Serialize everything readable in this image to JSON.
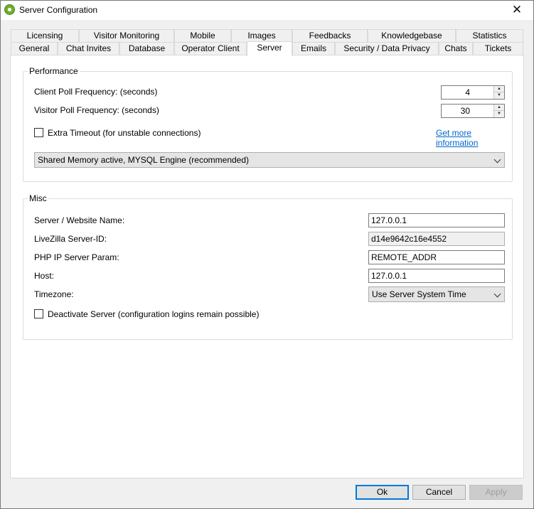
{
  "window": {
    "title": "Server Configuration",
    "close_glyph": "✕"
  },
  "tabs": {
    "row_back": [
      "Licensing",
      "Visitor Monitoring",
      "Mobile",
      "Images",
      "Feedbacks",
      "Knowledgebase",
      "Statistics"
    ],
    "row_front": [
      "General",
      "Chat Invites",
      "Database",
      "Operator Client",
      "Server",
      "Emails",
      "Security / Data Privacy",
      "Chats",
      "Tickets"
    ],
    "active": "Server"
  },
  "performance": {
    "legend": "Performance",
    "client_poll_label": "Client Poll Frequency: (seconds)",
    "client_poll_value": "4",
    "visitor_poll_label": "Visitor Poll Frequency: (seconds)",
    "visitor_poll_value": "30",
    "extra_timeout_label": "Extra Timeout (for unstable connections)",
    "extra_timeout_checked": false,
    "more_info_link": "Get more information",
    "engine_selected": "Shared Memory active, MYSQL Engine (recommended)"
  },
  "misc": {
    "legend": "Misc",
    "server_name_label": "Server / Website Name:",
    "server_name_value": "127.0.0.1",
    "server_id_label": "LiveZilla Server-ID:",
    "server_id_value": "d14e9642c16e4552",
    "php_ip_label": "PHP IP Server Param:",
    "php_ip_value": "REMOTE_ADDR",
    "host_label": "Host:",
    "host_value": "127.0.0.1",
    "timezone_label": "Timezone:",
    "timezone_selected": "Use Server System Time",
    "deactivate_label": "Deactivate Server (configuration logins remain possible)",
    "deactivate_checked": false
  },
  "buttons": {
    "ok": "Ok",
    "cancel": "Cancel",
    "apply": "Apply"
  },
  "icons": {
    "app": "livezilla-gear-icon",
    "spin_up": "▲",
    "spin_down": "▼"
  }
}
